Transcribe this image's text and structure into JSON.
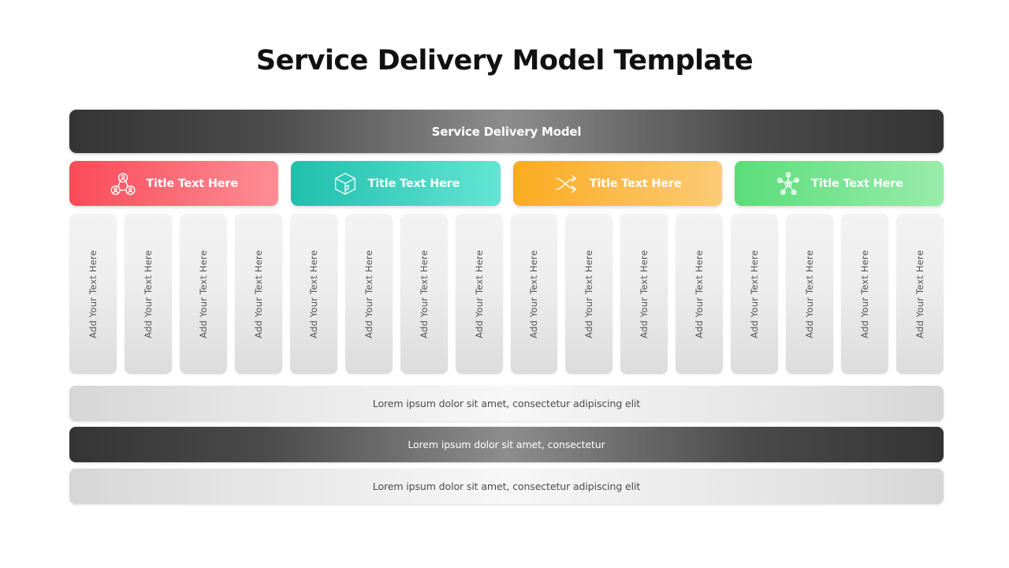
{
  "page_title": "Service Delivery Model Template",
  "master_bar": {
    "label": "Service Delivery Model",
    "gradient_edge": "#343434",
    "gradient_center": "#8d8d8d"
  },
  "categories": [
    {
      "label": "Title Text Here",
      "icon": "people-network-icon",
      "color_start": "#FB4A58",
      "color_end": "#FD8E96"
    },
    {
      "label": "Title Text Here",
      "icon": "package-box-icon",
      "color_start": "#1FBFAC",
      "color_end": "#63E5D4"
    },
    {
      "label": "Title Text Here",
      "icon": "shuffle-arrows-icon",
      "color_start": "#FBAB20",
      "color_end": "#FCCB76"
    },
    {
      "label": "Title Text Here",
      "icon": "hub-network-icon",
      "color_start": "#5BDD79",
      "color_end": "#99ECAB"
    }
  ],
  "columns": [
    {
      "label": "Add Your Text Here"
    },
    {
      "label": "Add Your Text Here"
    },
    {
      "label": "Add Your Text Here"
    },
    {
      "label": "Add Your Text Here"
    },
    {
      "label": "Add Your Text Here"
    },
    {
      "label": "Add Your Text Here"
    },
    {
      "label": "Add Your Text Here"
    },
    {
      "label": "Add Your Text Here"
    },
    {
      "label": "Add Your Text Here"
    },
    {
      "label": "Add Your Text Here"
    },
    {
      "label": "Add Your Text Here"
    },
    {
      "label": "Add Your Text Here"
    },
    {
      "label": "Add Your Text Here"
    },
    {
      "label": "Add Your Text Here"
    },
    {
      "label": "Add Your Text Here"
    },
    {
      "label": "Add Your Text Here"
    }
  ],
  "footer_bars": [
    {
      "label": "Lorem ipsum dolor sit amet, consectetur adipiscing elit",
      "style": "light"
    },
    {
      "label": "Lorem ipsum dolor sit amet, consectetur",
      "style": "dark"
    },
    {
      "label": "Lorem ipsum dolor sit amet, consectetur adipiscing elit",
      "style": "light"
    }
  ]
}
